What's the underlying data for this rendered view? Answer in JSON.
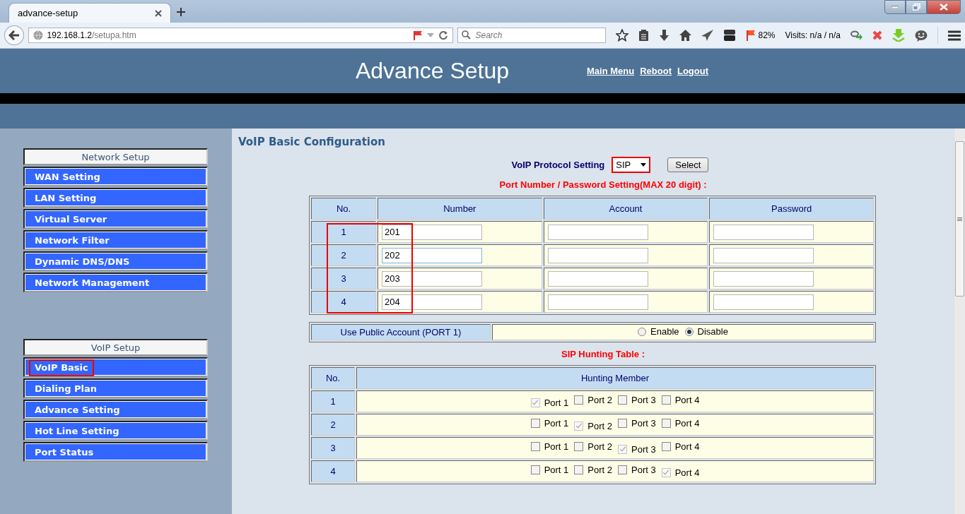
{
  "browser": {
    "tab": {
      "title": "advance-setup"
    },
    "address": {
      "host": "192.168.1.2",
      "path": "/setupa.htm"
    },
    "search": {
      "placeholder": "Search"
    },
    "zoom": "82%",
    "visits": "Visits: n/a / n/a"
  },
  "header": {
    "title": "Advance Setup",
    "links": [
      "Main Menu",
      "Reboot",
      "Logout"
    ]
  },
  "sidebar": {
    "groups": [
      {
        "title": "Network Setup",
        "items": [
          {
            "label": "WAN Setting",
            "selected": false
          },
          {
            "label": "LAN Setting",
            "selected": false
          },
          {
            "label": "Virtual Server",
            "selected": false
          },
          {
            "label": "Network Filter",
            "selected": false
          },
          {
            "label": "Dynamic DNS/DNS",
            "selected": false
          },
          {
            "label": "Network Management",
            "selected": false
          }
        ]
      },
      {
        "title": "VoIP Setup",
        "items": [
          {
            "label": "VoIP Basic",
            "selected": true
          },
          {
            "label": "Dialing Plan",
            "selected": false
          },
          {
            "label": "Advance Setting",
            "selected": false
          },
          {
            "label": "Hot Line Setting",
            "selected": false
          },
          {
            "label": "Port Status",
            "selected": false
          }
        ]
      }
    ]
  },
  "content": {
    "heading": "VoIP Basic Configuration",
    "protocol": {
      "label": "VoIP Protocol Setting",
      "value": "SIP",
      "highlighted": true,
      "button": "Select"
    },
    "port_section": {
      "title": "Port Number / Password Setting(MAX 20 digit) :",
      "columns": [
        "No.",
        "Number",
        "Account",
        "Password"
      ],
      "highlighted": true,
      "rows": [
        {
          "no": "1",
          "number": "201",
          "account": "",
          "password": "",
          "focused": false
        },
        {
          "no": "2",
          "number": "202",
          "account": "",
          "password": "",
          "focused": true
        },
        {
          "no": "3",
          "number": "203",
          "account": "",
          "password": "",
          "focused": false
        },
        {
          "no": "4",
          "number": "204",
          "account": "",
          "password": "",
          "focused": false
        }
      ]
    },
    "public_account": {
      "label": "Use Public Account (PORT 1)",
      "options": [
        {
          "label": "Enable",
          "selected": false
        },
        {
          "label": "Disable",
          "selected": true
        }
      ]
    },
    "hunting": {
      "title": "SIP Hunting Table :",
      "columns": [
        "No.",
        "Hunting Member"
      ],
      "rows": [
        {
          "no": "1",
          "ports": [
            {
              "label": "Port 1",
              "checked": true,
              "disabled": true
            },
            {
              "label": "Port 2",
              "checked": false,
              "disabled": false
            },
            {
              "label": "Port 3",
              "checked": false,
              "disabled": false
            },
            {
              "label": "Port 4",
              "checked": false,
              "disabled": false
            }
          ]
        },
        {
          "no": "2",
          "ports": [
            {
              "label": "Port 1",
              "checked": false,
              "disabled": false
            },
            {
              "label": "Port 2",
              "checked": true,
              "disabled": true
            },
            {
              "label": "Port 3",
              "checked": false,
              "disabled": false
            },
            {
              "label": "Port 4",
              "checked": false,
              "disabled": false
            }
          ]
        },
        {
          "no": "3",
          "ports": [
            {
              "label": "Port 1",
              "checked": false,
              "disabled": false
            },
            {
              "label": "Port 2",
              "checked": false,
              "disabled": false
            },
            {
              "label": "Port 3",
              "checked": true,
              "disabled": true
            },
            {
              "label": "Port 4",
              "checked": false,
              "disabled": false
            }
          ]
        },
        {
          "no": "4",
          "ports": [
            {
              "label": "Port 1",
              "checked": false,
              "disabled": false
            },
            {
              "label": "Port 2",
              "checked": false,
              "disabled": false
            },
            {
              "label": "Port 3",
              "checked": false,
              "disabled": false
            },
            {
              "label": "Port 4",
              "checked": true,
              "disabled": true
            }
          ]
        }
      ]
    }
  }
}
